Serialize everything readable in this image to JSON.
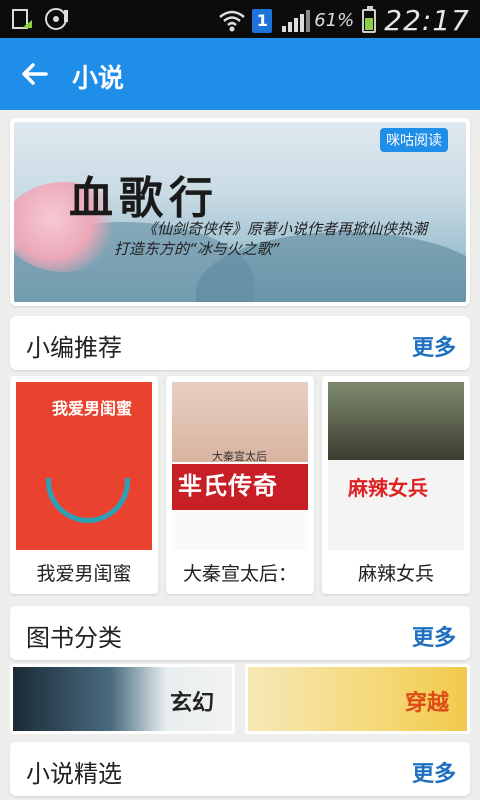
{
  "status_bar": {
    "sim_badge": "1",
    "battery_pct": "61%",
    "battery_level": 0.61,
    "time": "22:17"
  },
  "app_bar": {
    "title": "小说",
    "back_icon": "back-arrow-icon"
  },
  "banner": {
    "title": "血歌行",
    "line1": "《仙剑奇侠传》原著小说作者再掀仙侠热潮",
    "line2": "打造东方的“冰与火之歌”",
    "logo": "咪咕阅读"
  },
  "sections": {
    "recommend": {
      "title": "小编推荐",
      "more": "更多"
    },
    "category": {
      "title": "图书分类",
      "more": "更多"
    },
    "featured": {
      "title": "小说精选",
      "more": "更多"
    }
  },
  "books": [
    {
      "name": "我爱男闺蜜",
      "cover_text": "我爱男闺蜜"
    },
    {
      "name": "大秦宣太后：",
      "cover_text": "芈氏传奇",
      "cover_tag": "大秦宣太后"
    },
    {
      "name": "麻辣女兵",
      "cover_text": "麻辣女兵"
    }
  ],
  "categories": [
    {
      "label": "玄幻"
    },
    {
      "label": "穿越"
    }
  ],
  "colors": {
    "app_bar": "#1e8ee8",
    "more_link": "#1e6fc0",
    "background": "#eeeeec"
  }
}
